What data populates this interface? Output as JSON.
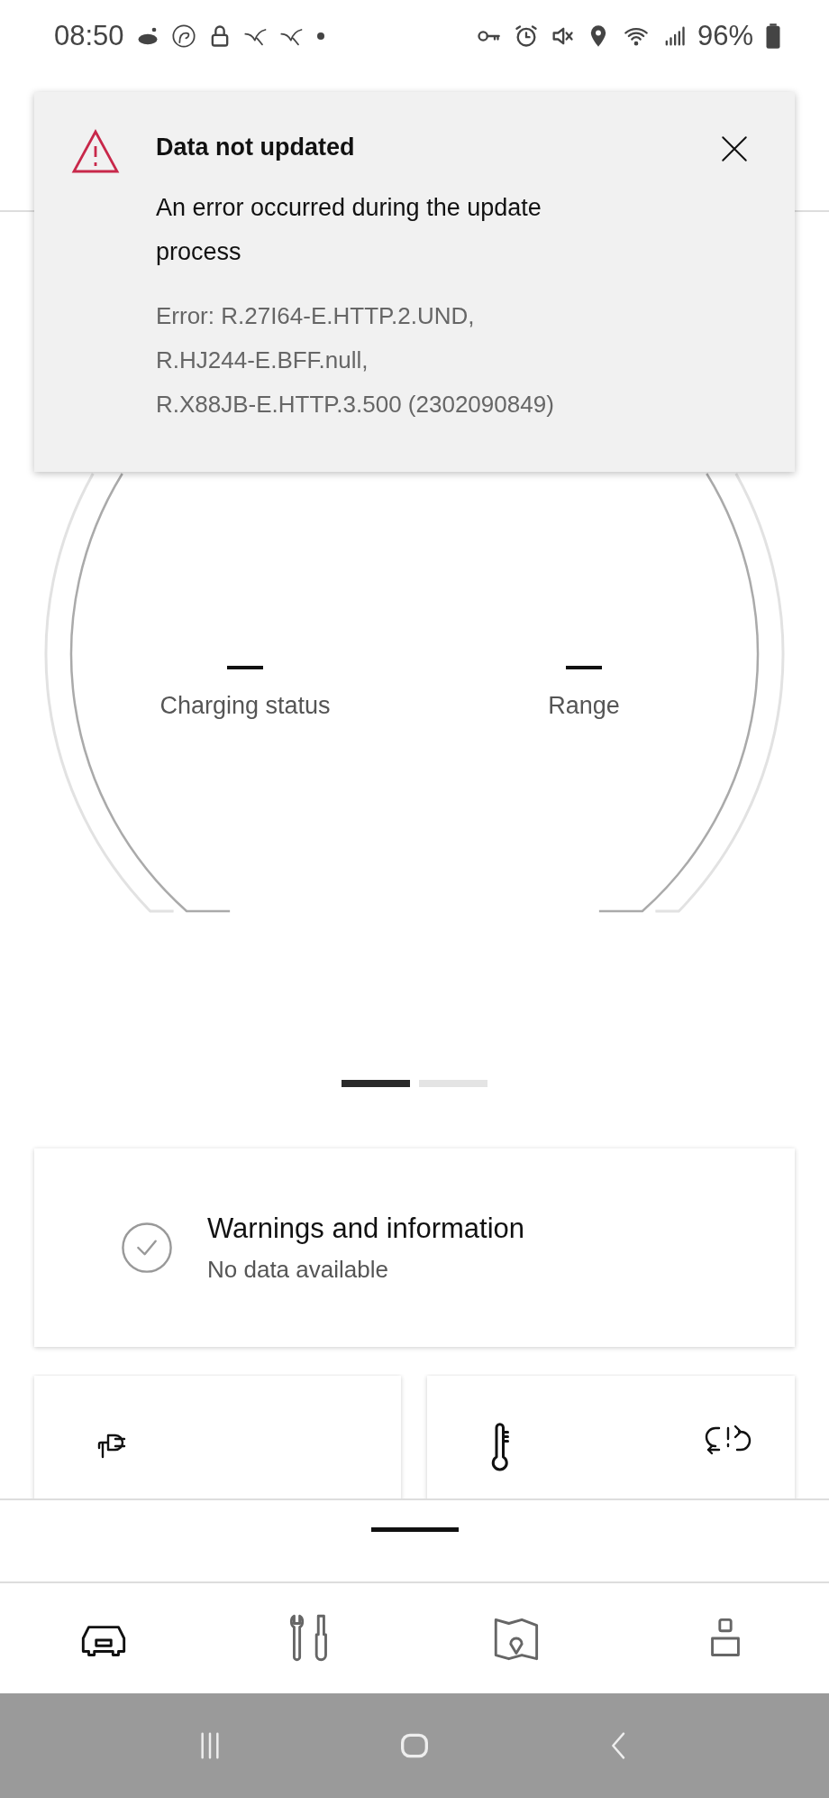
{
  "status_bar": {
    "time": "08:50",
    "battery": "96%"
  },
  "toast": {
    "title": "Data not updated",
    "message": "An error occurred during the update process",
    "error_lines": [
      "Error: R.27I64-E.HTTP.2.UND,",
      "R.HJ244-E.BFF.null,",
      "R.X88JB-E.HTTP.3.500 (2302090849)"
    ]
  },
  "gauge": {
    "readings": [
      {
        "value": "—",
        "label": "Charging status"
      },
      {
        "value": "—",
        "label": "Range"
      }
    ]
  },
  "pager": [
    {
      "selected": true
    },
    {
      "selected": false
    }
  ],
  "warnings_card": {
    "title": "Warnings and information",
    "subtitle": "No data available"
  },
  "tiles": [
    {
      "kind": "charging"
    },
    {
      "kind": "climate"
    }
  ],
  "bottom_nav": [
    {
      "kind": "car",
      "selected": true
    },
    {
      "kind": "tools",
      "selected": false
    },
    {
      "kind": "map",
      "selected": false
    },
    {
      "kind": "profile",
      "selected": false
    }
  ]
}
